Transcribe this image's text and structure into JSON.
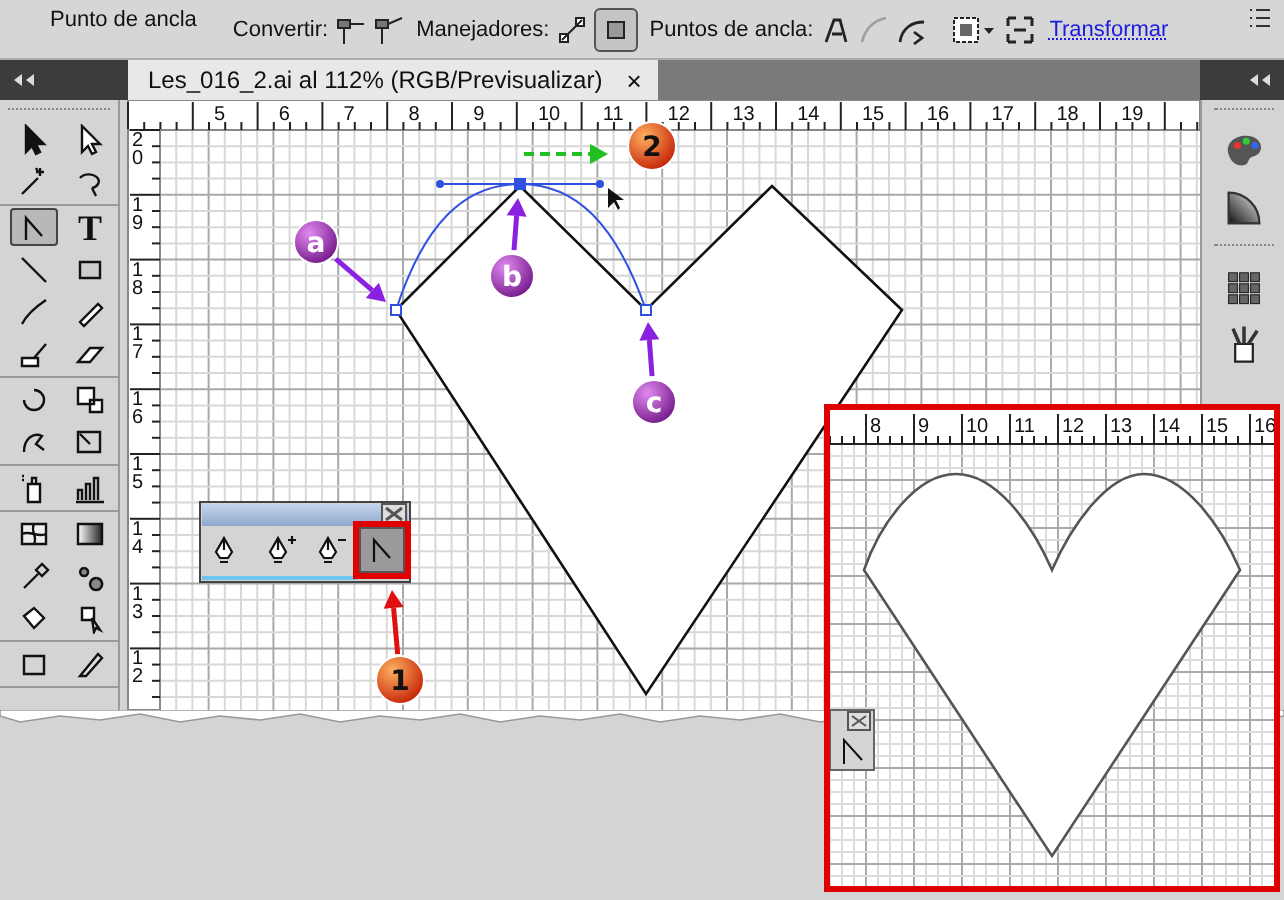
{
  "control_bar": {
    "title": "Punto de ancla",
    "convert_label": "Convertir:",
    "handles_label": "Manejadores:",
    "handles_buttons": [
      {
        "selected": false
      },
      {
        "selected": true
      }
    ],
    "anchors_label": "Puntos de ancla:",
    "anchor_buttons": [
      {
        "disabled": false
      },
      {
        "disabled": true
      },
      {
        "disabled": false
      }
    ],
    "transform_link": "Transformar"
  },
  "document_tab": {
    "title": "Les_016_2.ai al 112% (RGB/Previsualizar)",
    "close": "×"
  },
  "tools": [
    [
      {
        "kind": "selection",
        "selected": false
      },
      {
        "kind": "direct-selection",
        "selected": false
      },
      {
        "kind": "magic-wand",
        "selected": false
      },
      {
        "kind": "lasso",
        "selected": false
      }
    ],
    [
      {
        "kind": "convert-anchor",
        "selected": true
      },
      {
        "kind": "type",
        "label": "T",
        "selected": false
      },
      {
        "kind": "line",
        "selected": false
      },
      {
        "kind": "rectangle",
        "selected": false
      },
      {
        "kind": "brush",
        "selected": false
      },
      {
        "kind": "pencil",
        "selected": false
      },
      {
        "kind": "blob-brush",
        "selected": false
      },
      {
        "kind": "eraser",
        "selected": false
      }
    ],
    [
      {
        "kind": "rotate",
        "selected": false
      },
      {
        "kind": "scale",
        "selected": false
      },
      {
        "kind": "warp",
        "selected": false
      },
      {
        "kind": "free-transform",
        "selected": false
      }
    ],
    [
      {
        "kind": "symbol-sprayer",
        "selected": false
      },
      {
        "kind": "graph",
        "selected": false
      }
    ],
    [
      {
        "kind": "mesh",
        "selected": false
      },
      {
        "kind": "gradient",
        "selected": false
      },
      {
        "kind": "eyedropper",
        "selected": false
      },
      {
        "kind": "blend",
        "selected": false
      },
      {
        "kind": "live-paint",
        "selected": false
      },
      {
        "kind": "live-paint-select",
        "selected": false
      }
    ],
    [
      {
        "kind": "artboard",
        "selected": false
      },
      {
        "kind": "slice",
        "selected": false
      }
    ]
  ],
  "ruler": {
    "x_labels": [
      "5",
      "6",
      "7",
      "8",
      "9",
      "10",
      "11",
      "12",
      "13",
      "14",
      "15",
      "16",
      "17",
      "18",
      "19"
    ],
    "y_labels": [
      "20",
      "19",
      "18",
      "17",
      "16",
      "15",
      "14",
      "13",
      "12"
    ]
  },
  "anchor_panel": {
    "tools": [
      {
        "kind": "pen",
        "selected": false
      },
      {
        "kind": "add-anchor",
        "selected": false
      },
      {
        "kind": "delete-anchor",
        "selected": false
      },
      {
        "kind": "convert-anchor",
        "selected": true
      }
    ]
  },
  "callouts": [
    {
      "label": "a",
      "kind": "letter"
    },
    {
      "label": "b",
      "kind": "letter"
    },
    {
      "label": "c",
      "kind": "letter"
    },
    {
      "label": "2",
      "kind": "step"
    },
    {
      "label": "1",
      "kind": "step"
    }
  ],
  "inset": {
    "ruler_labels": [
      "8",
      "9",
      "10",
      "11",
      "12",
      "13",
      "14",
      "15",
      "16"
    ]
  }
}
